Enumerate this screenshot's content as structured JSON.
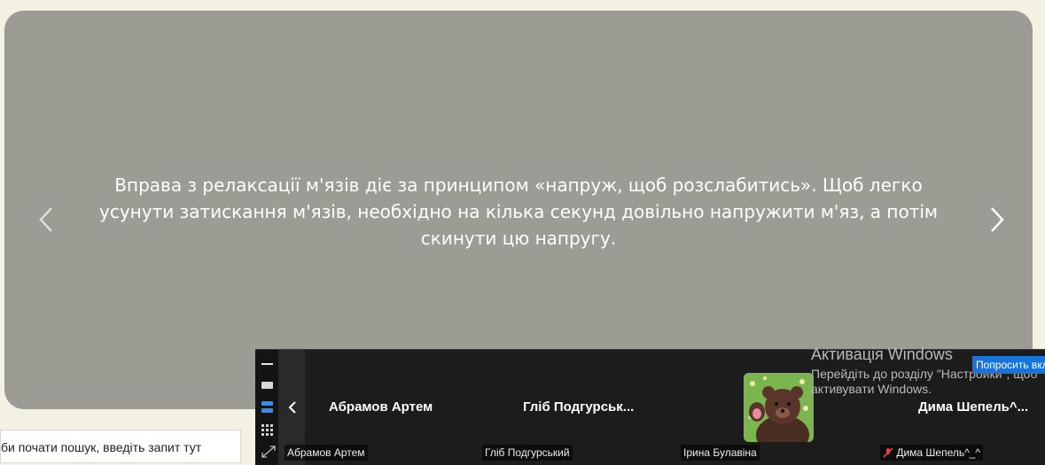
{
  "slide": {
    "text": "Вправа з релаксації м'язів діє за принципом «напруж, щоб розслабитись». Щоб легко усунути затискання м'язів, необхідно на кілька секунд довільно напружити м'яз, а потім скинути цю напругу.",
    "prev_icon": "chevron-left-icon",
    "next_icon": "chevron-right-icon"
  },
  "search": {
    "placeholder": "би почати пошук, введіть запит тут"
  },
  "meeting": {
    "participants_big": [
      "Абрамов Артем",
      "Гліб  Подгурськ...",
      "Дима  Шепель^..."
    ],
    "participants_tags": [
      "Абрамов Артем",
      "Гліб Подгурський",
      "Ірина Булавіна",
      "Дима Шепель^_^"
    ],
    "muted_icon": "mic-muted-icon",
    "tools": [
      "minimize-icon",
      "single-view-icon",
      "strip-view-icon",
      "grid-view-icon",
      "expand-icon"
    ]
  },
  "watermark": {
    "title": "Активація Windows",
    "line1": "Перейдіть до розділу \"Настройки\", щоб",
    "line2": "активувати Windows."
  },
  "ask_button": {
    "label": "Попросить вкл"
  },
  "colors": {
    "slide_bg": "#9c9b94",
    "accent": "#2d8cff",
    "button": "#1a73d8"
  }
}
